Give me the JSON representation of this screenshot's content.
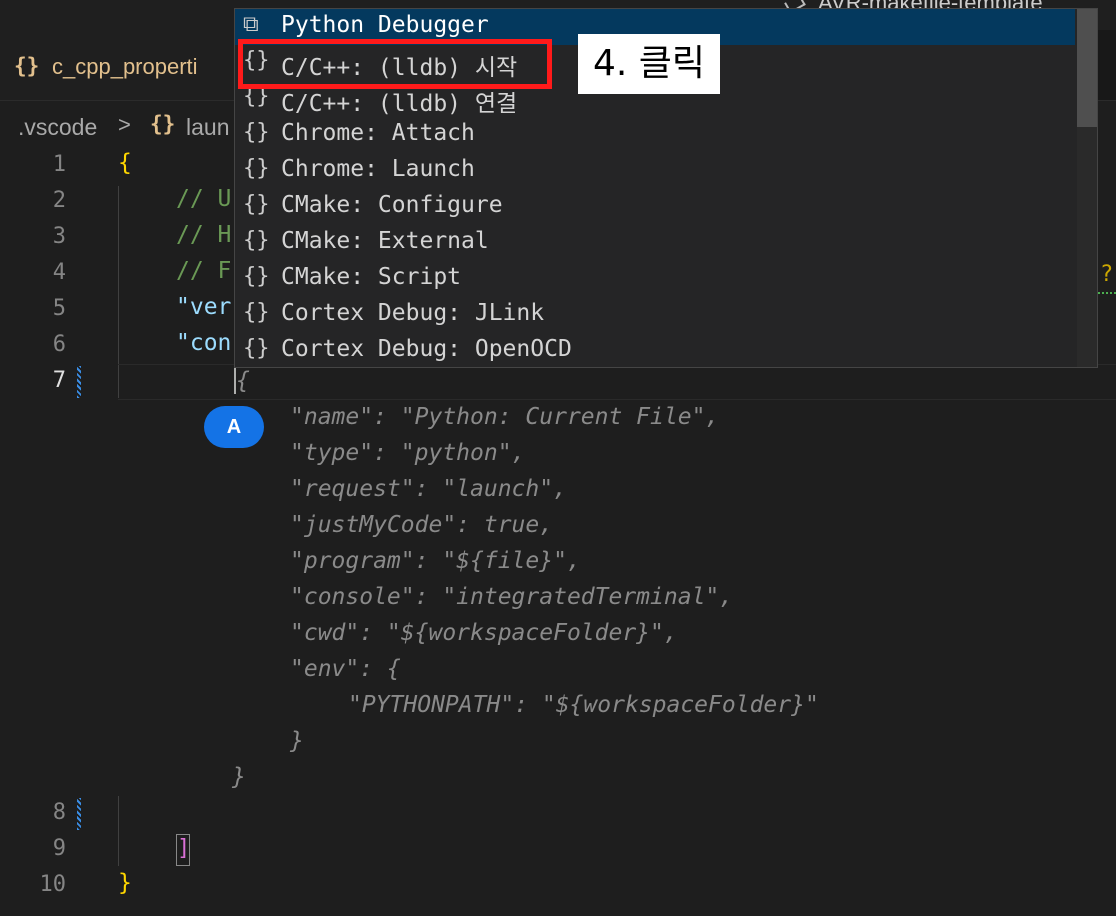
{
  "top_bar": {
    "window_title": "AVR-makefile-template"
  },
  "tab": {
    "icon": "{}",
    "label": "c_cpp_properti"
  },
  "breadcrumb": {
    "folder": ".vscode",
    "separator": ">",
    "icon": "{}",
    "file": "laun"
  },
  "editor": {
    "line_numbers": [
      "1",
      "2",
      "3",
      "4",
      "5",
      "6",
      "7",
      "8",
      "9",
      "10"
    ],
    "lines": {
      "l1": "{",
      "l2": "// U",
      "l3": "// H",
      "l4": "// F",
      "l5": "\"ver",
      "l6": "\"con",
      "l10": "}"
    },
    "ghost_lines": [
      "{",
      "\"name\": \"Python: Current File\",",
      "\"type\": \"python\",",
      "\"request\": \"launch\",",
      "\"justMyCode\": true,",
      "\"program\": \"${file}\",",
      "\"console\": \"integratedTerminal\",",
      "\"cwd\": \"${workspaceFolder}\",",
      "\"env\": {",
      "\"PYTHONPATH\": \"${workspaceFolder}\"",
      "}",
      "}"
    ],
    "line9_bracket": "]",
    "line4_trailing": "?"
  },
  "avatar": {
    "label": "A"
  },
  "suggest": {
    "items": [
      {
        "icon": "python-debugger-icon",
        "glyph": "⧉",
        "label": "Python Debugger",
        "selected": true
      },
      {
        "icon": "braces-icon",
        "glyph": "{}",
        "label": "C/C++: (lldb) 시작",
        "selected": false
      },
      {
        "icon": "braces-icon",
        "glyph": "{}",
        "label": "C/C++: (lldb) 연결",
        "selected": false
      },
      {
        "icon": "braces-icon",
        "glyph": "{}",
        "label": "Chrome: Attach",
        "selected": false
      },
      {
        "icon": "braces-icon",
        "glyph": "{}",
        "label": "Chrome: Launch",
        "selected": false
      },
      {
        "icon": "braces-icon",
        "glyph": "{}",
        "label": "CMake: Configure",
        "selected": false
      },
      {
        "icon": "braces-icon",
        "glyph": "{}",
        "label": "CMake: External",
        "selected": false
      },
      {
        "icon": "braces-icon",
        "glyph": "{}",
        "label": "CMake: Script",
        "selected": false
      },
      {
        "icon": "braces-icon",
        "glyph": "{}",
        "label": "Cortex Debug: JLink",
        "selected": false
      },
      {
        "icon": "braces-icon",
        "glyph": "{}",
        "label": "Cortex Debug: OpenOCD",
        "selected": false
      }
    ]
  },
  "annotation": {
    "label": "4. 클릭",
    "highlight_color": "#ff1a1a"
  },
  "colors": {
    "brace": "#ffd700",
    "comment": "#6a9955",
    "string_key": "#9cdcfe",
    "selection": "#04395e"
  }
}
